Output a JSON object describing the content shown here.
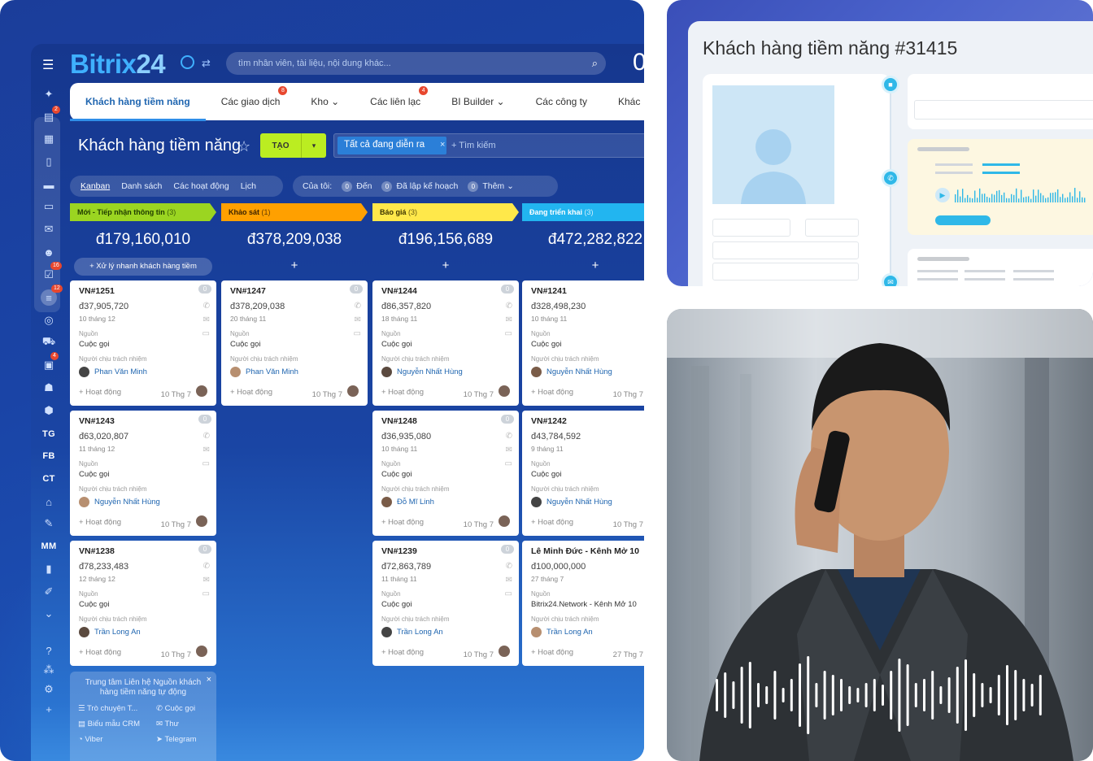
{
  "app": {
    "logo_main": "Bitrix",
    "logo_num": "24",
    "search_placeholder": "tìm nhân viên, tài liệu, nội dung khác...",
    "clock_fragment": "0"
  },
  "tabs": [
    {
      "label": "Khách hàng tiềm năng",
      "badge": ""
    },
    {
      "label": "Các giao dịch",
      "badge": "8"
    },
    {
      "label": "Kho",
      "badge": ""
    },
    {
      "label": "Các liên lạc",
      "badge": "4"
    },
    {
      "label": "BI Builder",
      "badge": ""
    },
    {
      "label": "Các công ty",
      "badge": ""
    },
    {
      "label": "Khác",
      "badge": ""
    }
  ],
  "page": {
    "title": "Khách hàng tiềm năng",
    "create_label": "TẠO",
    "filter_chip": "Tất cả đang diễn ra",
    "filter_search": "+ Tìm kiếm"
  },
  "views": [
    "Kanban",
    "Danh sách",
    "Các hoạt động",
    "Lịch"
  ],
  "mine": {
    "label": "Của tôi:",
    "items": [
      {
        "count": "0",
        "label": "Đến"
      },
      {
        "count": "0",
        "label": "Đã lập kế hoạch"
      },
      {
        "count": "0",
        "label": "Thêm"
      }
    ]
  },
  "rail": {
    "badges": [
      "2",
      "16",
      "12",
      "4"
    ],
    "texts": [
      "TG",
      "FB",
      "CT",
      "MM"
    ]
  },
  "columns": [
    {
      "name": "Mới - Tiếp nhận thông tin",
      "count": "(3)",
      "color": "#9bd521",
      "text_color": "#1f3b00",
      "sum": "đ179,160,010",
      "quick": "Xử lý nhanh khách hàng tiềm",
      "cards": [
        {
          "id": "VN#1251",
          "amount": "đ37,905,720",
          "date": "10 tháng 12",
          "src_label": "Nguồn",
          "src": "Cuộc gọi",
          "resp_label": "Người chịu trách nhiệm",
          "user": "Phan Văn Minh",
          "act": "+ Hoạt động",
          "foot_date": "10 Thg 7",
          "badge": "0"
        },
        {
          "id": "VN#1243",
          "amount": "đ63,020,807",
          "date": "11 tháng 12",
          "src_label": "Nguồn",
          "src": "Cuộc gọi",
          "resp_label": "Người chịu trách nhiệm",
          "user": "Nguyễn Nhất Hùng",
          "act": "+ Hoạt động",
          "foot_date": "10 Thg 7",
          "badge": "0"
        },
        {
          "id": "VN#1238",
          "amount": "đ78,233,483",
          "date": "12 tháng 12",
          "src_label": "Nguồn",
          "src": "Cuộc gọi",
          "resp_label": "Người chịu trách nhiệm",
          "user": "Trần Long An",
          "act": "+ Hoạt động",
          "foot_date": "10 Thg 7",
          "badge": "0"
        }
      ]
    },
    {
      "name": "Khảo sát",
      "count": "(1)",
      "color": "#ffa000",
      "text_color": "#3b2300",
      "sum": "đ378,209,038",
      "quick": "",
      "cards": [
        {
          "id": "VN#1247",
          "amount": "đ378,209,038",
          "date": "20 tháng 11",
          "src_label": "Nguồn",
          "src": "Cuộc gọi",
          "resp_label": "Người chịu trách nhiệm",
          "user": "Phan Văn Minh",
          "act": "+ Hoạt động",
          "foot_date": "10 Thg 7",
          "badge": "0"
        }
      ]
    },
    {
      "name": "Báo giá",
      "count": "(3)",
      "color": "#ffe84a",
      "text_color": "#3b3300",
      "sum": "đ196,156,689",
      "quick": "",
      "cards": [
        {
          "id": "VN#1244",
          "amount": "đ86,357,820",
          "date": "18 tháng 11",
          "src_label": "Nguồn",
          "src": "Cuộc gọi",
          "resp_label": "Người chịu trách nhiệm",
          "user": "Nguyễn Nhất Hùng",
          "act": "+ Hoạt động",
          "foot_date": "10 Thg 7",
          "badge": "0"
        },
        {
          "id": "VN#1248",
          "amount": "đ36,935,080",
          "date": "10 tháng 11",
          "src_label": "Nguồn",
          "src": "Cuộc gọi",
          "resp_label": "Người chịu trách nhiệm",
          "user": "Đỗ Mĩ Linh",
          "act": "+ Hoạt động",
          "foot_date": "10 Thg 7",
          "badge": "0"
        },
        {
          "id": "VN#1239",
          "amount": "đ72,863,789",
          "date": "11 tháng 11",
          "src_label": "Nguồn",
          "src": "Cuộc gọi",
          "resp_label": "Người chịu trách nhiệm",
          "user": "Trần Long An",
          "act": "+ Hoạt động",
          "foot_date": "10 Thg 7",
          "badge": "0"
        }
      ]
    },
    {
      "name": "Đang triển khai",
      "count": "(3)",
      "color": "#22b5f0",
      "text_color": "#ffffff",
      "sum": "đ472,282,822",
      "quick": "",
      "cards": [
        {
          "id": "VN#1241",
          "amount": "đ328,498,230",
          "date": "10 tháng 11",
          "src_label": "Nguồn",
          "src": "Cuộc gọi",
          "resp_label": "Người chịu trách nhiệm",
          "user": "Nguyễn Nhất Hùng",
          "act": "+ Hoạt động",
          "foot_date": "10 Thg 7",
          "badge": ""
        },
        {
          "id": "VN#1242",
          "amount": "đ43,784,592",
          "date": "9 tháng 11",
          "src_label": "Nguồn",
          "src": "Cuộc gọi",
          "resp_label": "Người chịu trách nhiệm",
          "user": "Nguyễn Nhất Hùng",
          "act": "+ Hoạt động",
          "foot_date": "10 Thg 7",
          "badge": ""
        },
        {
          "id": "Lê Minh Đức - Kênh Mở 10",
          "amount": "đ100,000,000",
          "date": "27 tháng 7",
          "src_label": "Nguồn",
          "src": "Bitrix24.Network - Kênh Mở 10",
          "resp_label": "Người chịu trách nhiệm",
          "user": "Trần Long An",
          "act": "+ Hoạt động",
          "foot_date": "27 Thg 7",
          "badge": ""
        }
      ]
    }
  ],
  "info_box": {
    "title": "Trung tâm Liên hệ Nguồn khách hàng tiềm năng tự động",
    "channels": [
      "Trò chuyện T...",
      "Cuộc gọi",
      "Biểu mẫu CRM",
      "Thư",
      "Viber",
      "Telegram"
    ]
  },
  "lead_card": {
    "title": "Khách hàng tiềm năng #31415"
  }
}
